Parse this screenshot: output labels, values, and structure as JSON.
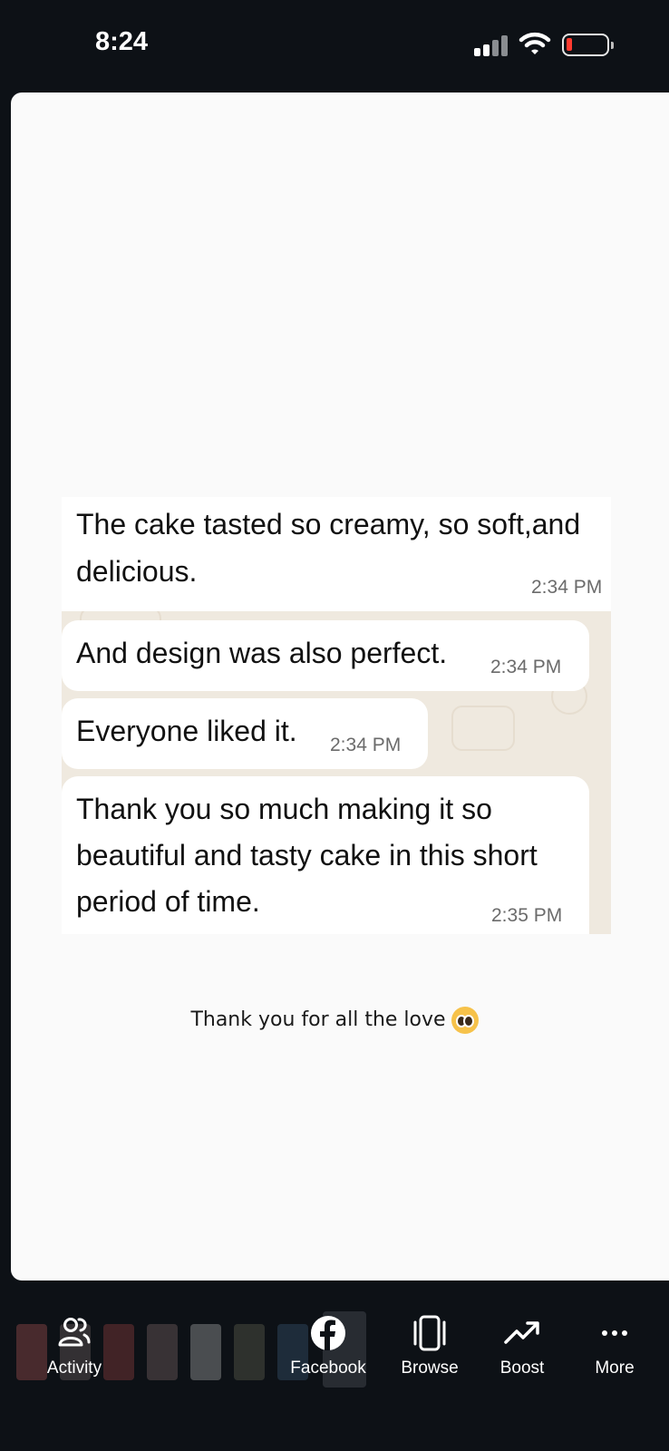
{
  "status_bar": {
    "time": "8:24"
  },
  "chat": {
    "messages": [
      {
        "lines": [
          "The cake tasted so creamy, so soft,and",
          "delicious."
        ],
        "time": "2:34 PM"
      },
      {
        "lines": [
          "And design was also perfect."
        ],
        "time": "2:34 PM"
      },
      {
        "lines": [
          "Everyone liked it."
        ],
        "time": "2:34 PM"
      },
      {
        "lines": [
          "Thank you so much making it so",
          "beautiful and tasty cake in this short",
          "period of time."
        ],
        "time": "2:35 PM"
      }
    ]
  },
  "caption": "Thank you for all the love",
  "bottom_nav": {
    "activity": "Activity",
    "facebook": "Facebook",
    "browse": "Browse",
    "boost": "Boost",
    "more": "More"
  },
  "colors": {
    "background": "#0d1116",
    "card": "#fafafa",
    "chat_wallpaper": "#efe9df",
    "battery_low": "#ff3b30"
  }
}
